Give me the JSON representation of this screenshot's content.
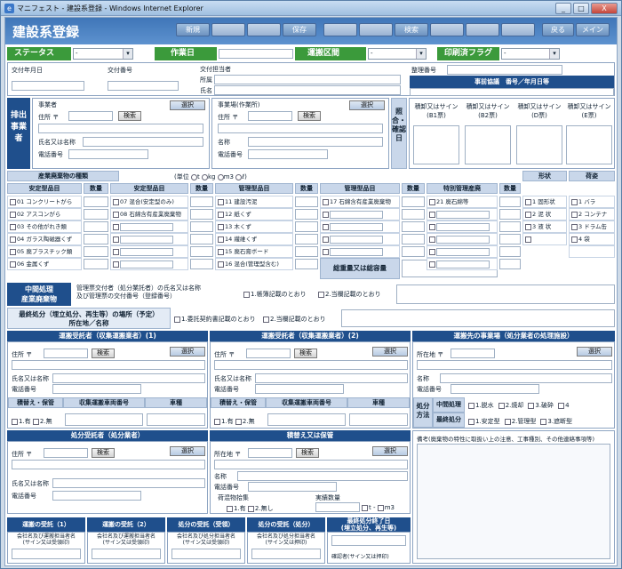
{
  "window": {
    "title": "マニフェスト - 建設系登録 - Windows Internet Explorer",
    "min": "_",
    "max": "□",
    "close": "X"
  },
  "header": {
    "app_title": "建設系登録",
    "new_label": "新規",
    "save_label": "保存",
    "search_label": "検索",
    "back_label": "戻る",
    "main_label": "メイン"
  },
  "statusbar": {
    "status_label": "ステータス",
    "date_label": "作業日",
    "section_label": "運搬区間",
    "print_label": "印刷済フラグ",
    "status_value": "-",
    "section_value": "-",
    "print_value": "-"
  },
  "issue": {
    "issue_date": "交付年月日",
    "issue_no": "交付番号",
    "person": "交付担当者",
    "dept": "所属",
    "name": "氏名",
    "ref_no": "整理番号",
    "contract": "事前協議　番号／年月日等"
  },
  "emitter": {
    "title_v": "排出事業者",
    "biz": "事業者",
    "addr": "住所 〒",
    "search": "検索",
    "select": "選択",
    "name_label": "氏名又は名称",
    "tel": "電話番号",
    "site": "事業場(作業所)",
    "site_addr": "住所 〒",
    "site_name": "名称",
    "site_tel": "電話番号",
    "site_select": "選択",
    "site_search": "検索"
  },
  "check": {
    "title_v": "照合・確認日",
    "cols": [
      "積卸又はサイン\n(B1票)",
      "積卸又はサイン\n(B2票)",
      "積卸又はサイン\n(D票)",
      "積卸又はサイン\n(E票)"
    ]
  },
  "waste": {
    "title": "産業廃棄物の種類",
    "unit_label": "(単位",
    "unit_t": "t",
    "unit_kg": "kg",
    "unit_m3": "m3",
    "unit_l": "ℓ)",
    "qty": "数量",
    "h_safe": "安定型品目",
    "h_manage": "管理型品目",
    "h_special": "特別管理産廃",
    "h_shape": "形状",
    "h_pack": "荷姿",
    "total": "総重量又は総容量",
    "col1": [
      "01 コンクリートがら",
      "02 アスコンがら",
      "03 その他がれき類",
      "04 ガラス陶磁器くず",
      "05 廃プラスチック類",
      "06 金属くず"
    ],
    "col2": [
      "07 混合(安定型のみ)",
      "08 石綿含有産業廃棄物"
    ],
    "col3": [
      "11 建設汚泥",
      "12 紙くず",
      "13 木くず",
      "14 繊維くず",
      "15 廃石膏ボード",
      "16 混合(管理型含む)"
    ],
    "col4": [
      "17 石綿含有産業廃棄物"
    ],
    "col5": [
      "21 廃石綿等"
    ],
    "shapes": [
      "1 固形状",
      "2 泥 状",
      "3 液 状"
    ],
    "packs": [
      "1 バラ",
      "2 コンテナ",
      "3 ドラム缶",
      "4 袋"
    ]
  },
  "intermediate": {
    "title": "中間処理\n産業廃棄物",
    "desc": "管理票交付者（処分業託者）の氏名又は名称\n及び管理票の交付番号（登録番号）",
    "opt1": "1.帳簿記載のとおり",
    "opt2": "2.当欄記載のとおり"
  },
  "final": {
    "title": "最終処分（埋立処分、再生等）の場所（予定）\n所在地／名称",
    "opt1": "1.委託契約書記載のとおり",
    "opt2": "2.当欄記載のとおり"
  },
  "transport1": {
    "title": "運搬受託者（収集運搬業者）(1)",
    "addr": "住所 〒",
    "search": "検索",
    "select": "選択",
    "name": "氏名又は名称",
    "tel": "電話番号",
    "transfer": "積替え・保管",
    "vehicle_no": "収集運搬車両番号",
    "vehicle": "車種",
    "opt_yes": "1.有",
    "opt_no": "2.無"
  },
  "transport2": {
    "title": "運搬受託者（収集運搬業者）(2)",
    "addr": "住所 〒",
    "search": "検索",
    "select": "選択",
    "name": "氏名又は名称",
    "tel": "電話番号",
    "transfer": "積替え・保管",
    "vehicle_no": "収集運搬車両番号",
    "vehicle": "車種",
    "opt_yes": "1.有",
    "opt_no": "2.無"
  },
  "destination": {
    "title": "運搬先の事業場（処分業者の処理施設）",
    "addr": "所在地 〒",
    "select": "選択",
    "name": "名称",
    "tel": "電話番号",
    "method": "処分方法",
    "mid": "中間処理",
    "final": "最終処分",
    "mid_opts": [
      "1.脱水",
      "2.焼却",
      "3.破砕",
      "4"
    ],
    "final_opts": [
      "1.安定型",
      "2.管理型",
      "3.遮断型"
    ]
  },
  "disposer": {
    "title": "処分受託者（処分業者）",
    "addr": "住所 〒",
    "search": "検索",
    "select": "選択",
    "name": "氏名又は名称",
    "tel": "電話番号"
  },
  "storage": {
    "title": "積替え又は保管",
    "addr": "所在地 〒",
    "search": "検索",
    "select": "選択",
    "name": "名称",
    "tel": "電話番号",
    "mixed": "荷混物拾集",
    "opt_yes": "1.有",
    "opt_no": "2.無し",
    "qty": "実績数量",
    "unit_t": "t",
    "unit_m3": "m3"
  },
  "remarks": {
    "label": "備考(廃棄物の特性に取扱い上の注意、工事種別、その他連絡事項等)"
  },
  "receipts": {
    "r1": "運搬の受託（1）",
    "r2": "運搬の受託（2）",
    "r3": "処分の受託（受領）",
    "r4": "処分の受託（処分）",
    "r5": "最終処分終了日\n(埋立処分、再生等)",
    "sub": "会社名及び運搬担当者名\n(サイン又は受領印)",
    "sub3": "会社名及び処分担当者名\n(サイン又は受領印)",
    "sub4": "会社名及び処分担当者名\n(サイン又は押印)",
    "sub5": "確認者(サイン又は押印)"
  }
}
